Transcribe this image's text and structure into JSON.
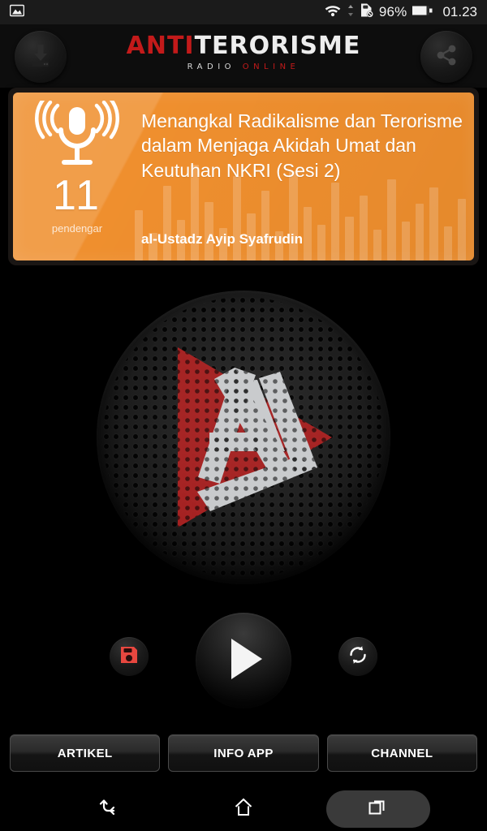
{
  "statusbar": {
    "left_icon": "gallery-image-icon",
    "wifi_icon": "wifi-icon",
    "data_arrows_icon": "data-transfer-icon",
    "sim_icon": "no-sim-card-icon",
    "battery_percent": "96%",
    "battery_icon": "battery-icon",
    "clock": "01.23"
  },
  "header": {
    "download_button": "download-icon",
    "share_button": "share-icon",
    "logo_part1": "ANTI",
    "logo_part2": "TERORISME",
    "logo_sub1": "RADIO",
    "logo_sub2": "ONLINE",
    "accent_red": "#c31a1a",
    "accent_white": "#ededed"
  },
  "card": {
    "mic_icon": "microphone-icon",
    "listener_count": "11",
    "listener_label": "pendengar",
    "title": "Menangkal Radikalisme dan Terorisme dalam Menjaga Akidah Umat dan Keutuhan NKRI (Sesi 2)",
    "speaker": "al-Ustadz Ayip Syafrudin",
    "background_color": "#ef8f2e",
    "eq_bars": [
      62,
      34,
      92,
      50,
      118,
      72,
      40,
      104,
      58,
      86,
      36,
      110,
      66,
      44,
      96,
      54,
      80,
      38,
      100,
      48,
      70,
      90,
      42,
      76
    ]
  },
  "logo_disc": {
    "icon": "al-play-triangle-logo",
    "triangle_color": "#a92222",
    "letters_color": "#c8cacc"
  },
  "controls": {
    "save_button": "save-floppy-icon",
    "play_button": "play-icon",
    "refresh_button": "refresh-icon",
    "save_icon_color": "#e8473f"
  },
  "actions": [
    {
      "label": "ARTIKEL",
      "name": "artikel-button"
    },
    {
      "label": "INFO APP",
      "name": "info-app-button"
    },
    {
      "label": "CHANNEL",
      "name": "channel-button"
    }
  ],
  "navbar": {
    "back": "back-icon",
    "home": "home-icon",
    "recent": "recent-apps-icon"
  }
}
